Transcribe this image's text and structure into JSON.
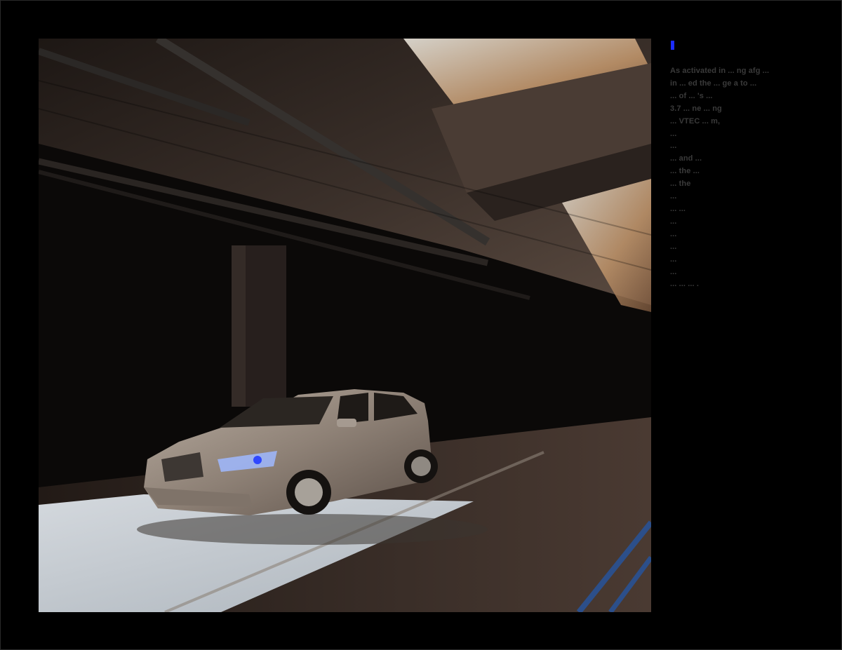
{
  "page": {
    "background": "#000000",
    "accent_color": "#1c2cff",
    "text_color": "#3a3a3a"
  },
  "photo": {
    "subject": "silver sedan under overpass"
  },
  "body_text": "As activated in ... ng afg ... \nin ... ed the ... ge a to ... \n... of ... 's ... \n3.7 ... ne ... ng \n... VTEC ... m, \n... \n... \n... and ... \n... the ... \n... the \n... \n... ... \n... \n... \n... \n... \n... \n... ... ... ."
}
